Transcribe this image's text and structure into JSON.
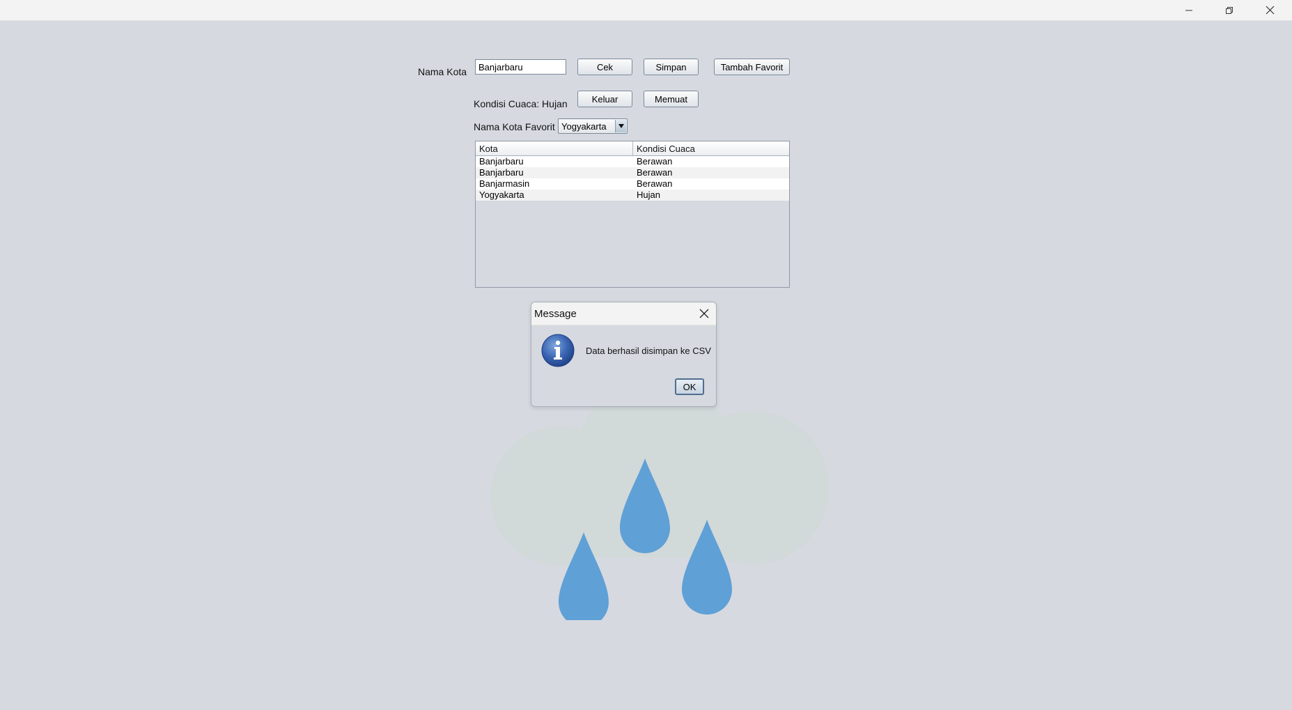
{
  "window": {
    "controls": {
      "minimize_icon": "minimize-icon",
      "maximize_icon": "restore-icon",
      "close_icon": "close-icon"
    }
  },
  "form": {
    "city_label": "Nama Kota",
    "city_value": "Banjarbaru",
    "buttons": {
      "cek": "Cek",
      "simpan": "Simpan",
      "tambah_favorit": "Tambah Favorit",
      "keluar": "Keluar",
      "memuat": "Memuat"
    },
    "condition_text": "Kondisi Cuaca: Hujan",
    "favorite_label": "Nama Kota Favorit",
    "favorite_selected": "Yogyakarta"
  },
  "table": {
    "columns": [
      "Kota",
      "Kondisi Cuaca"
    ],
    "rows": [
      [
        "Banjarbaru",
        "Berawan"
      ],
      [
        "Banjarbaru",
        "Berawan"
      ],
      [
        "Banjarmasin",
        "Berawan"
      ],
      [
        "Yogyakarta",
        "Hujan"
      ]
    ]
  },
  "dialog": {
    "title": "Message",
    "message": "Data berhasil disimpan ke CSV",
    "ok_label": "OK",
    "icon": "info-icon"
  },
  "illustration": {
    "icon": "rain-cloud-icon",
    "cloud_color": "#d2d9d9",
    "drop_color": "#5fa0d6"
  },
  "colors": {
    "background": "#d6d9e0",
    "titlebar": "#f3f3f3"
  }
}
